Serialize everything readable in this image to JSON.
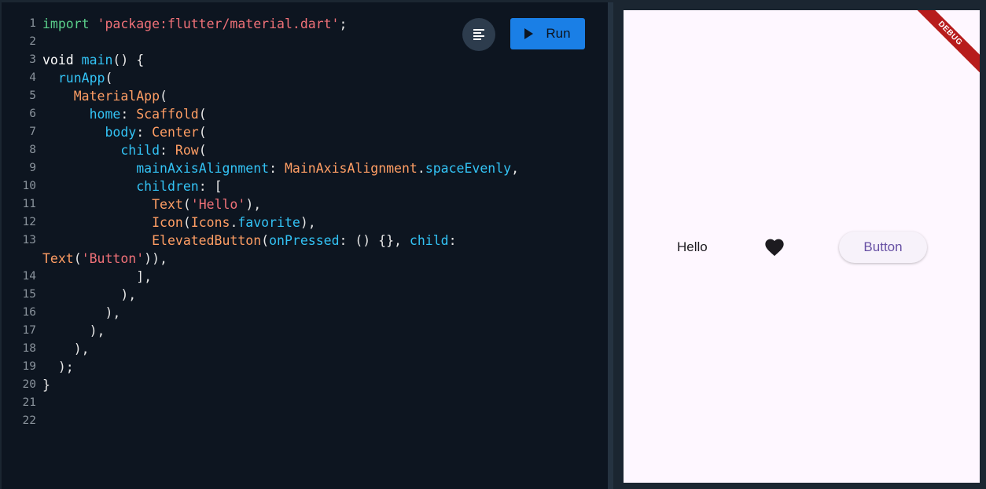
{
  "editor": {
    "lines": [
      {
        "n": "1",
        "tokens": [
          [
            "import ",
            "kw"
          ],
          [
            "'package:flutter/material.dart'",
            "str"
          ],
          [
            ";",
            "punc"
          ]
        ]
      },
      {
        "n": "2",
        "tokens": []
      },
      {
        "n": "3",
        "tokens": [
          [
            "void ",
            "ident"
          ],
          [
            "main",
            "fn"
          ],
          [
            "() {",
            "punc"
          ]
        ]
      },
      {
        "n": "4",
        "tokens": [
          [
            "  ",
            "punc"
          ],
          [
            "runApp",
            "fn"
          ],
          [
            "(",
            "punc"
          ]
        ]
      },
      {
        "n": "5",
        "tokens": [
          [
            "    ",
            "punc"
          ],
          [
            "MaterialApp",
            "class"
          ],
          [
            "(",
            "punc"
          ]
        ]
      },
      {
        "n": "6",
        "tokens": [
          [
            "      ",
            "punc"
          ],
          [
            "home",
            "prop"
          ],
          [
            ": ",
            "punc"
          ],
          [
            "Scaffold",
            "class"
          ],
          [
            "(",
            "punc"
          ]
        ]
      },
      {
        "n": "7",
        "tokens": [
          [
            "        ",
            "punc"
          ],
          [
            "body",
            "prop"
          ],
          [
            ": ",
            "punc"
          ],
          [
            "Center",
            "class"
          ],
          [
            "(",
            "punc"
          ]
        ]
      },
      {
        "n": "8",
        "tokens": [
          [
            "          ",
            "punc"
          ],
          [
            "child",
            "prop"
          ],
          [
            ": ",
            "punc"
          ],
          [
            "Row",
            "class"
          ],
          [
            "(",
            "punc"
          ]
        ]
      },
      {
        "n": "9",
        "tokens": [
          [
            "            ",
            "punc"
          ],
          [
            "mainAxisAlignment",
            "prop"
          ],
          [
            ": ",
            "punc"
          ],
          [
            "MainAxisAlignment",
            "class"
          ],
          [
            ".",
            "punc"
          ],
          [
            "spaceEvenly",
            "prop"
          ],
          [
            ",",
            "punc"
          ]
        ]
      },
      {
        "n": "10",
        "tokens": [
          [
            "            ",
            "punc"
          ],
          [
            "children",
            "prop"
          ],
          [
            ": [",
            "punc"
          ]
        ]
      },
      {
        "n": "11",
        "tokens": [
          [
            "              ",
            "punc"
          ],
          [
            "Text",
            "class"
          ],
          [
            "(",
            "punc"
          ],
          [
            "'Hello'",
            "str"
          ],
          [
            "),",
            "punc"
          ]
        ]
      },
      {
        "n": "12",
        "tokens": [
          [
            "              ",
            "punc"
          ],
          [
            "Icon",
            "class"
          ],
          [
            "(",
            "punc"
          ],
          [
            "Icons",
            "class"
          ],
          [
            ".",
            "punc"
          ],
          [
            "favorite",
            "prop"
          ],
          [
            "),",
            "punc"
          ]
        ]
      },
      {
        "n": "13",
        "tokens": [
          [
            "              ",
            "punc"
          ],
          [
            "ElevatedButton",
            "class"
          ],
          [
            "(",
            "punc"
          ],
          [
            "onPressed",
            "prop"
          ],
          [
            ": () {}, ",
            "punc"
          ],
          [
            "child",
            "prop"
          ],
          [
            ":",
            "punc"
          ]
        ]
      },
      {
        "n": "",
        "tokens": [
          [
            "Text",
            "class"
          ],
          [
            "(",
            "punc"
          ],
          [
            "'Button'",
            "str"
          ],
          [
            ")),",
            "punc"
          ]
        ]
      },
      {
        "n": "14",
        "tokens": [
          [
            "            ",
            "punc"
          ],
          [
            "],",
            "punc"
          ]
        ]
      },
      {
        "n": "15",
        "tokens": [
          [
            "          ",
            "punc"
          ],
          [
            "),",
            "punc"
          ]
        ]
      },
      {
        "n": "16",
        "tokens": [
          [
            "        ",
            "punc"
          ],
          [
            "),",
            "punc"
          ]
        ]
      },
      {
        "n": "17",
        "tokens": [
          [
            "      ",
            "punc"
          ],
          [
            "),",
            "punc"
          ]
        ]
      },
      {
        "n": "18",
        "tokens": [
          [
            "    ",
            "punc"
          ],
          [
            "),",
            "punc"
          ]
        ]
      },
      {
        "n": "19",
        "tokens": [
          [
            "  ",
            "punc"
          ],
          [
            ");",
            "punc"
          ]
        ]
      },
      {
        "n": "20",
        "tokens": [
          [
            "}",
            "punc"
          ]
        ]
      },
      {
        "n": "21",
        "tokens": []
      },
      {
        "n": "22",
        "tokens": []
      }
    ]
  },
  "toolbar": {
    "format_icon": "format-align-left-icon",
    "run_icon": "play-icon",
    "run_label": "Run"
  },
  "preview": {
    "debug_banner": "DEBUG",
    "hello_text": "Hello",
    "heart_icon": "favorite-heart-icon",
    "button_label": "Button"
  },
  "colors": {
    "editor_bg": "#0d1520",
    "run_button": "#1a7fe6",
    "preview_bg": "#fef7ff",
    "button_text": "#6750a4",
    "debug_banner": "#b71c1c"
  }
}
